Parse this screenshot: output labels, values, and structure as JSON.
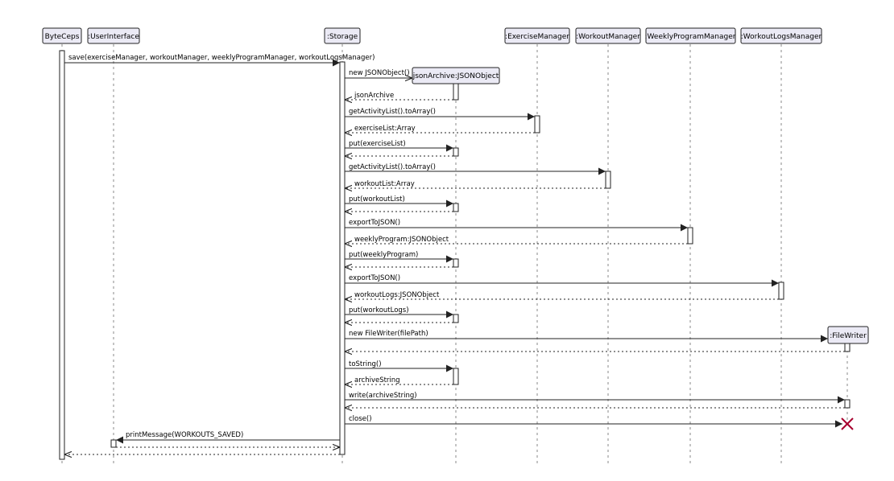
{
  "participants": [
    {
      "id": "byteceps",
      "label": "ByteCeps"
    },
    {
      "id": "ui",
      "label": ":UserInterface"
    },
    {
      "id": "storage",
      "label": ":Storage"
    },
    {
      "id": "exercise",
      "label": ":ExerciseManager"
    },
    {
      "id": "workout",
      "label": ":WorkoutManager"
    },
    {
      "id": "weekly",
      "label": ":WeeklyProgramManager"
    },
    {
      "id": "logs",
      "label": ":WorkoutLogsManager"
    },
    {
      "id": "json",
      "label": "jsonArchive:JSONObject"
    },
    {
      "id": "filewriter",
      "label": ":FileWriter"
    }
  ],
  "messages": [
    {
      "id": "save",
      "from": "byteceps",
      "to": "storage",
      "label": "save(exerciseManager, workoutManager, weeklyProgramManager, workoutLogsManager)",
      "type": "sync"
    },
    {
      "id": "new-json",
      "from": "storage",
      "to": "json",
      "label": "new JSONObject()",
      "type": "create"
    },
    {
      "id": "ret-json",
      "from": "json",
      "to": "storage",
      "label": "jsonArchive",
      "type": "return"
    },
    {
      "id": "get-ex",
      "from": "storage",
      "to": "exercise",
      "label": "getActivityList().toArray()",
      "type": "sync"
    },
    {
      "id": "ret-ex",
      "from": "exercise",
      "to": "storage",
      "label": "exerciseList:Array",
      "type": "return"
    },
    {
      "id": "put-ex",
      "from": "storage",
      "to": "json",
      "label": "put(exerciseList)",
      "type": "sync"
    },
    {
      "id": "ret-put-ex",
      "from": "json",
      "to": "storage",
      "label": "",
      "type": "return"
    },
    {
      "id": "get-wo",
      "from": "storage",
      "to": "workout",
      "label": "getActivityList().toArray()",
      "type": "sync"
    },
    {
      "id": "ret-wo",
      "from": "workout",
      "to": "storage",
      "label": "workoutList:Array",
      "type": "return"
    },
    {
      "id": "put-wo",
      "from": "storage",
      "to": "json",
      "label": "put(workoutList)",
      "type": "sync"
    },
    {
      "id": "ret-put-wo",
      "from": "json",
      "to": "storage",
      "label": "",
      "type": "return"
    },
    {
      "id": "export-wp",
      "from": "storage",
      "to": "weekly",
      "label": "exportToJSON()",
      "type": "sync"
    },
    {
      "id": "ret-wp",
      "from": "weekly",
      "to": "storage",
      "label": "weeklyProgram:JSONObject",
      "type": "return"
    },
    {
      "id": "put-wp",
      "from": "storage",
      "to": "json",
      "label": "put(weeklyProgram)",
      "type": "sync"
    },
    {
      "id": "ret-put-wp",
      "from": "json",
      "to": "storage",
      "label": "",
      "type": "return"
    },
    {
      "id": "export-wl",
      "from": "storage",
      "to": "logs",
      "label": "exportToJSON()",
      "type": "sync"
    },
    {
      "id": "ret-wl",
      "from": "logs",
      "to": "storage",
      "label": "workoutLogs:JSONObject",
      "type": "return"
    },
    {
      "id": "put-wl",
      "from": "storage",
      "to": "json",
      "label": "put(workoutLogs)",
      "type": "sync"
    },
    {
      "id": "ret-put-wl",
      "from": "json",
      "to": "storage",
      "label": "",
      "type": "return"
    },
    {
      "id": "new-fw",
      "from": "storage",
      "to": "filewriter",
      "label": "new FileWriter(filePath)",
      "type": "create"
    },
    {
      "id": "ret-fw",
      "from": "filewriter",
      "to": "storage",
      "label": "",
      "type": "return"
    },
    {
      "id": "tostring",
      "from": "storage",
      "to": "json",
      "label": "toString()",
      "type": "sync"
    },
    {
      "id": "ret-tostring",
      "from": "json",
      "to": "storage",
      "label": "archiveString",
      "type": "return"
    },
    {
      "id": "write",
      "from": "storage",
      "to": "filewriter",
      "label": "write(archiveString)",
      "type": "sync"
    },
    {
      "id": "ret-write",
      "from": "filewriter",
      "to": "storage",
      "label": "",
      "type": "return"
    },
    {
      "id": "close",
      "from": "storage",
      "to": "filewriter",
      "label": "close()",
      "type": "destroy"
    },
    {
      "id": "print",
      "from": "storage",
      "to": "ui",
      "label": "printMessage(WORKOUTS_SAVED)",
      "type": "sync"
    },
    {
      "id": "ret-print",
      "from": "ui",
      "to": "storage",
      "label": "",
      "type": "return"
    },
    {
      "id": "ret-save",
      "from": "storage",
      "to": "byteceps",
      "label": "",
      "type": "return"
    }
  ],
  "colors": {
    "participant_fill": "#ebeaf5",
    "participant_stroke": "#222222",
    "line": "#222222",
    "destroy": "#a8002e"
  }
}
